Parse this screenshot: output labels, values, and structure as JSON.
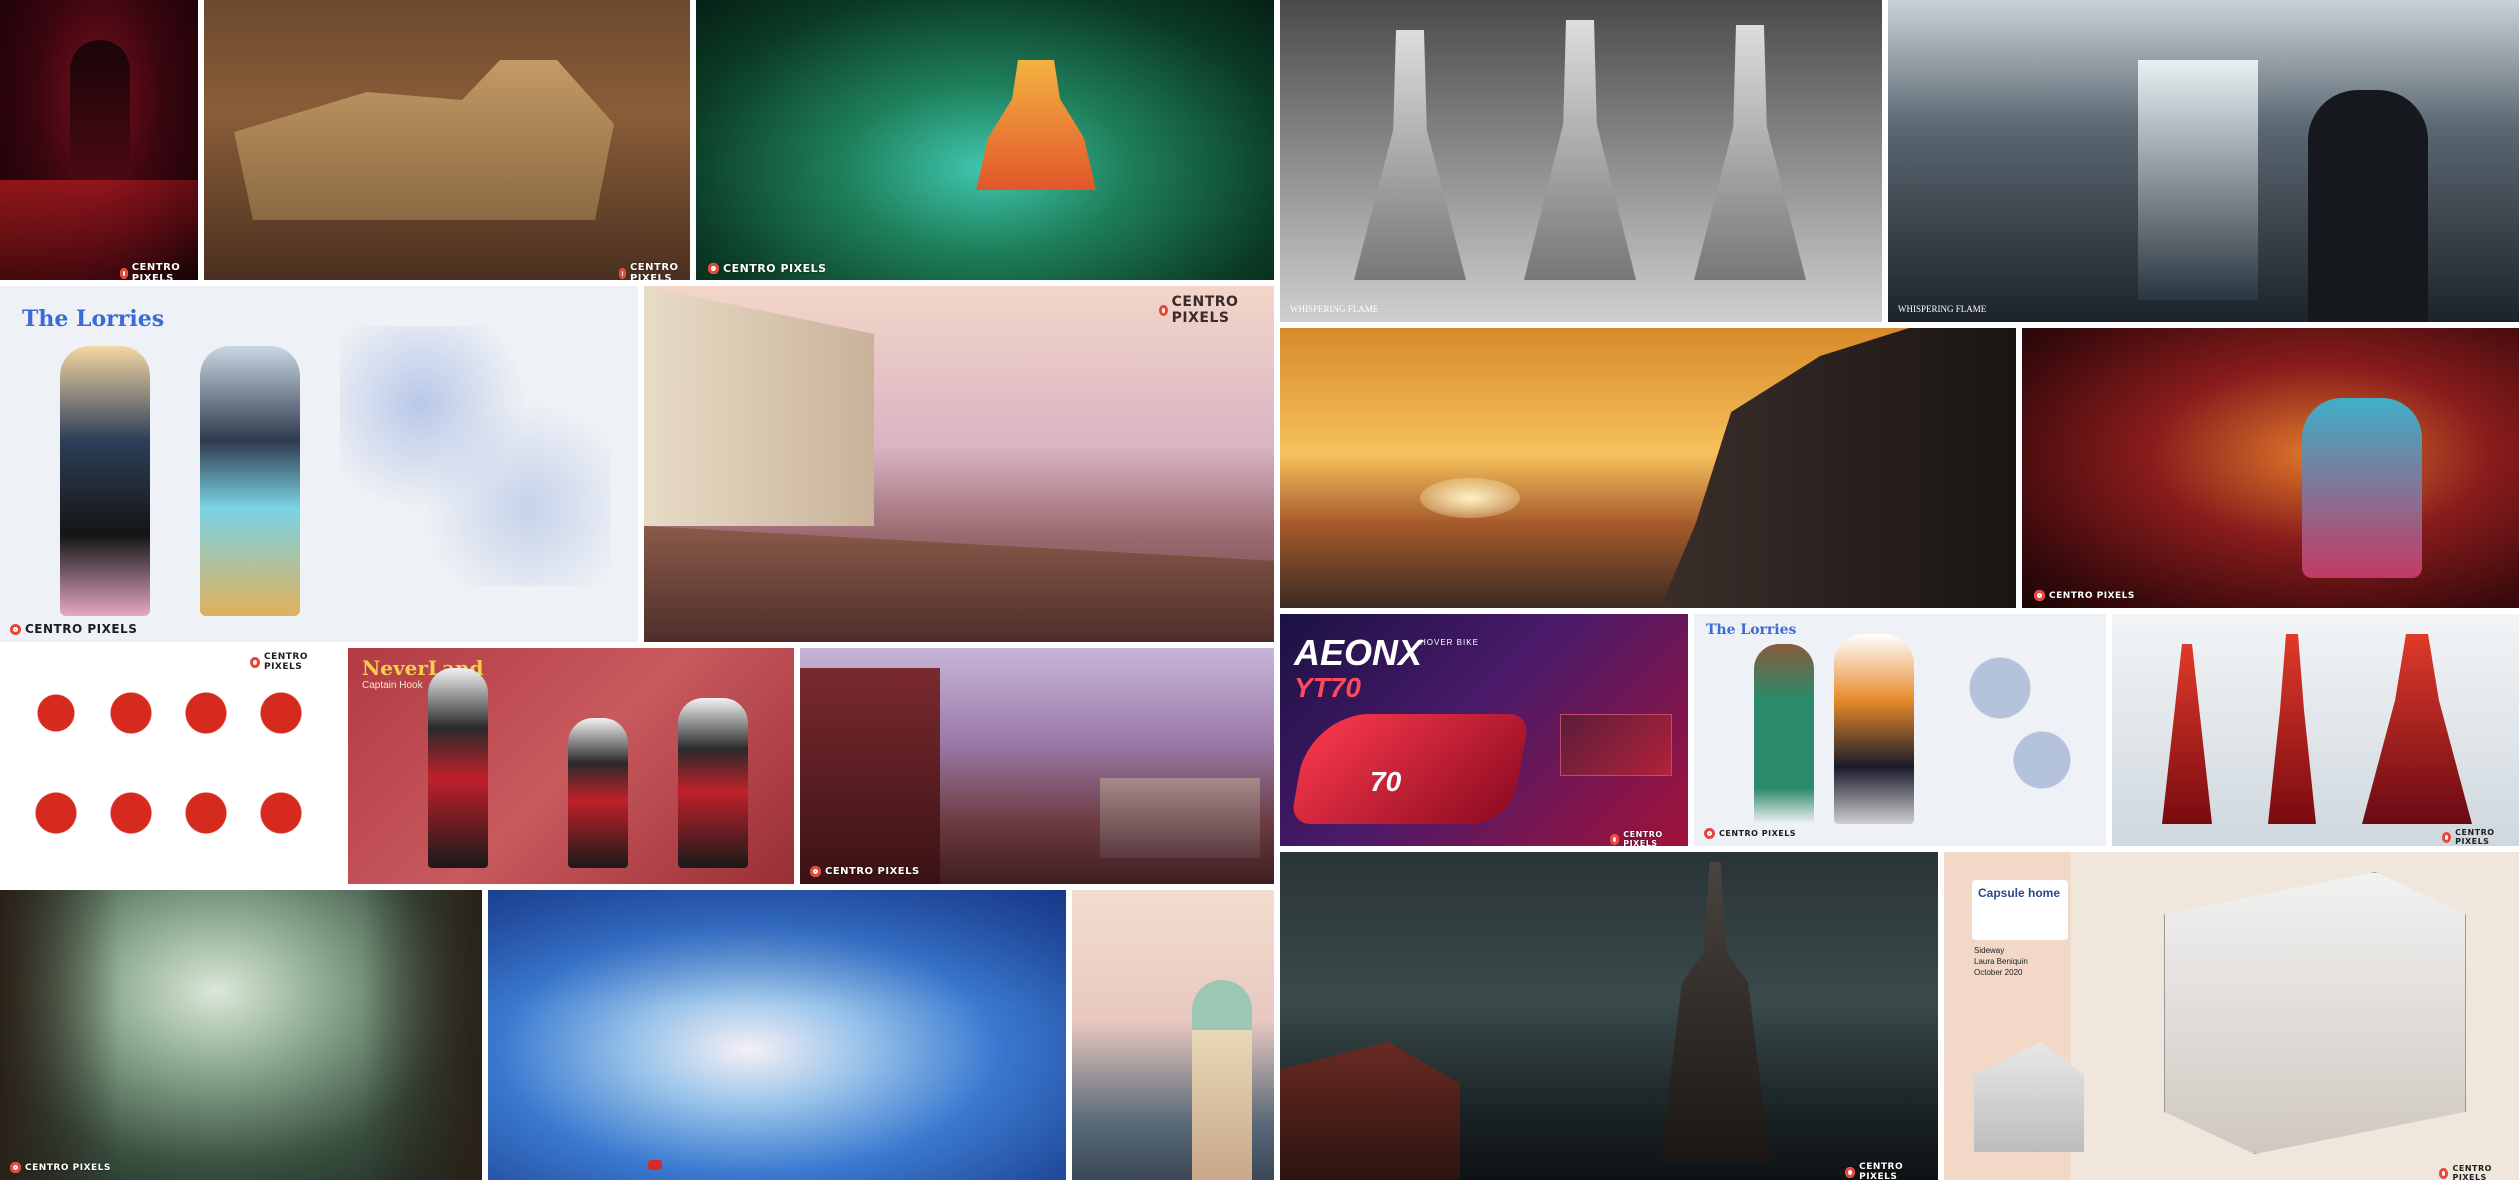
{
  "watermark": "CENTRO PIXELS",
  "tiles": {
    "creature_red": {
      "wm": "CENTRO PIXELS"
    },
    "castle": {
      "wm": "CENTRO PIXELS"
    },
    "jungle_temple": {
      "wm": "CENTRO PIXELS"
    },
    "tentacle_figures": {
      "title": "WHISPERING FLAME"
    },
    "interior_hall": {
      "title": "WHISPERING FLAME"
    },
    "archer_sheet": {
      "logo_text": "The Lorries",
      "wm": "CENTRO PIXELS"
    },
    "harbor_street": {
      "wm": "CENTRO PIXELS"
    },
    "sunset_cliffs": {},
    "red_lair": {
      "wm": "CENTRO PIXELS"
    },
    "red_hair_heads": {
      "wm": "CENTRO PIXELS"
    },
    "neverland": {
      "title": "NeverLand",
      "subtitle": "Captain Hook"
    },
    "bedroom": {
      "wm": "CENTRO PIXELS"
    },
    "aeonx": {
      "title": "AEONX",
      "subtitle": "YT70",
      "tag": "HOVER BIKE",
      "number": "70",
      "wm": "CENTRO PIXELS"
    },
    "two_characters": {
      "logo_text": "The Lorries",
      "wm": "CENTRO PIXELS"
    },
    "red_creatures": {
      "wm": "CENTRO PIXELS"
    },
    "forest": {
      "wm": "CENTRO PIXELS"
    },
    "ice_cave": {},
    "lighthouse": {},
    "night_castle": {
      "wm": "CENTRO PIXELS"
    },
    "capsule_home": {
      "title": "Capsule home",
      "lines": [
        "Sideway",
        "Laura Beniquin",
        "October 2020"
      ],
      "wm": "CENTRO PIXELS"
    }
  },
  "colors": {
    "accent": "#e8463a",
    "background": "#ffffff"
  }
}
